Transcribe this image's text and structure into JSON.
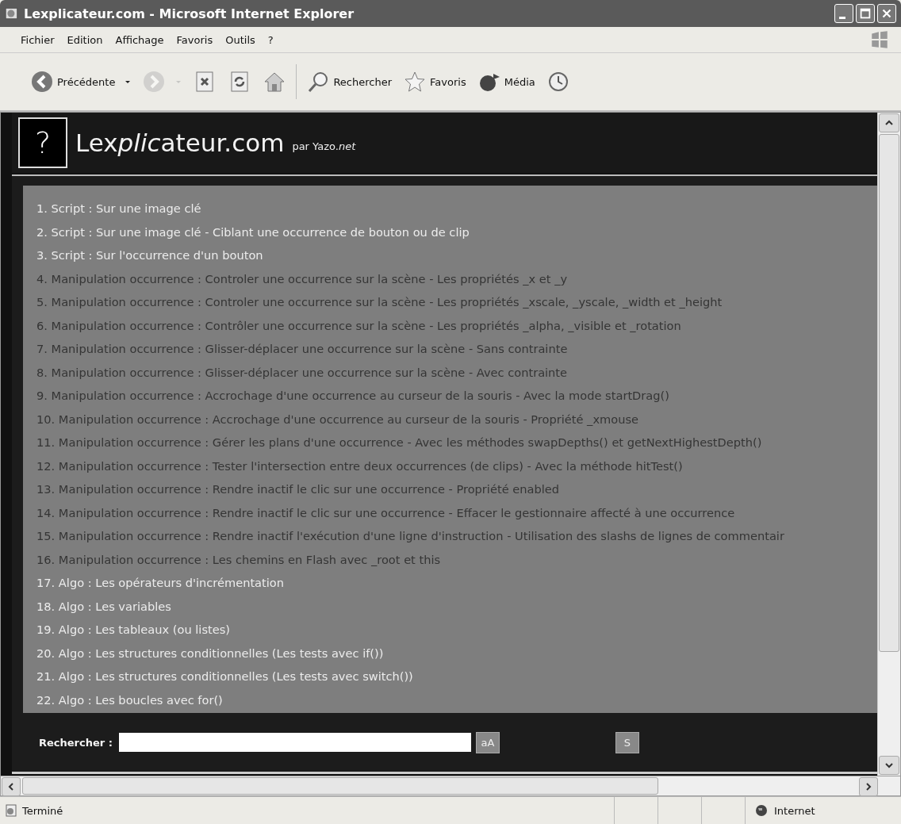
{
  "window": {
    "title": "Lexplicateur.com - Microsoft Internet Explorer"
  },
  "menu": [
    {
      "label": "Fichier"
    },
    {
      "label": "Edition"
    },
    {
      "label": "Affichage"
    },
    {
      "label": "Favoris"
    },
    {
      "label": "Outils"
    },
    {
      "label": "?"
    }
  ],
  "toolbar": [
    {
      "kind": "back",
      "label": "Précédente",
      "disabled": false
    },
    {
      "kind": "forward",
      "disabled": true
    },
    {
      "kind": "stop",
      "disabled": false
    },
    {
      "kind": "refresh",
      "disabled": false
    },
    {
      "kind": "home",
      "disabled": false
    },
    {
      "kind": "search",
      "label": "Rechercher",
      "disabled": false
    },
    {
      "kind": "favorites",
      "label": "Favoris",
      "disabled": false
    },
    {
      "kind": "media",
      "label": "Média",
      "disabled": false
    },
    {
      "kind": "history",
      "disabled": false
    }
  ],
  "site": {
    "logo_mark": "?",
    "name_parts": [
      {
        "text": "Lex",
        "italic": false
      },
      {
        "text": "plic",
        "italic": true
      },
      {
        "text": "ateur.com",
        "italic": false
      }
    ],
    "byline": "par Yazo.*net*"
  },
  "items": [
    {
      "text": "1. Script : Sur une image clé",
      "color": "#ececec"
    },
    {
      "text": "2. Script : Sur une image clé - Ciblant une occurrence de bouton ou de clip",
      "color": "#ececec"
    },
    {
      "text": "3. Script : Sur l'occurrence d'un bouton",
      "color": "#ececec"
    },
    {
      "text": "4. Manipulation occurrence : Controler une occurrence sur la scène - Les propriétés _x et _y",
      "color": "#353535"
    },
    {
      "text": "5. Manipulation occurrence : Controler une occurrence sur la scène - Les propriétés _xscale, _yscale, _width et _height",
      "color": "#353535"
    },
    {
      "text": "6. Manipulation occurrence : Contrôler une occurrence sur la scène - Les propriétés _alpha, _visible et _rotation",
      "color": "#353535"
    },
    {
      "text": "7. Manipulation occurrence : Glisser-déplacer une occurrence sur la scène - Sans contrainte",
      "color": "#353535"
    },
    {
      "text": "8. Manipulation occurrence : Glisser-déplacer une occurrence sur la scène - Avec contrainte",
      "color": "#353535"
    },
    {
      "text": "9. Manipulation occurrence : Accrochage d'une occurrence au curseur de la souris - Avec la mode startDrag()",
      "color": "#353535"
    },
    {
      "text": "10. Manipulation occurrence : Accrochage d'une occurrence au curseur de la souris - Propriété _xmouse",
      "color": "#353535"
    },
    {
      "text": "11. Manipulation occurrence : Gérer les plans d'une occurrence - Avec les méthodes swapDepths() et getNextHighestDepth()",
      "color": "#353535"
    },
    {
      "text": "12. Manipulation occurrence : Tester l'intersection entre deux occurrences (de clips) - Avec la méthode hitTest()",
      "color": "#353535"
    },
    {
      "text": "13. Manipulation occurrence : Rendre inactif le clic sur une occurrence - Propriété enabled",
      "color": "#353535"
    },
    {
      "text": "14. Manipulation occurrence : Rendre inactif le clic sur une occurrence - Effacer le gestionnaire affecté à une occurrence",
      "color": "#353535"
    },
    {
      "text": "15. Manipulation occurrence : Rendre inactif l'exécution d'une ligne d'instruction - Utilisation des slashs de lignes de commentair",
      "color": "#353535"
    },
    {
      "text": "16. Manipulation occurrence : Les chemins en Flash avec _root et this",
      "color": "#353535"
    },
    {
      "text": "17. Algo : Les opérateurs d'incrémentation",
      "color": "#ececec"
    },
    {
      "text": "18. Algo : Les variables",
      "color": "#ececec"
    },
    {
      "text": "19. Algo : Les tableaux (ou listes)",
      "color": "#ececec"
    },
    {
      "text": "20. Algo : Les structures conditionnelles (Les tests avec if())",
      "color": "#ececec"
    },
    {
      "text": "21. Algo : Les structures conditionnelles (Les tests avec switch())",
      "color": "#ececec"
    },
    {
      "text": "22. Algo : Les boucles avec for()",
      "color": "#ececec"
    }
  ],
  "search": {
    "label": "Rechercher :",
    "case_button": "aA",
    "submit_button": "S"
  },
  "status_bar": {
    "text": "Terminé",
    "zone": "Internet"
  }
}
